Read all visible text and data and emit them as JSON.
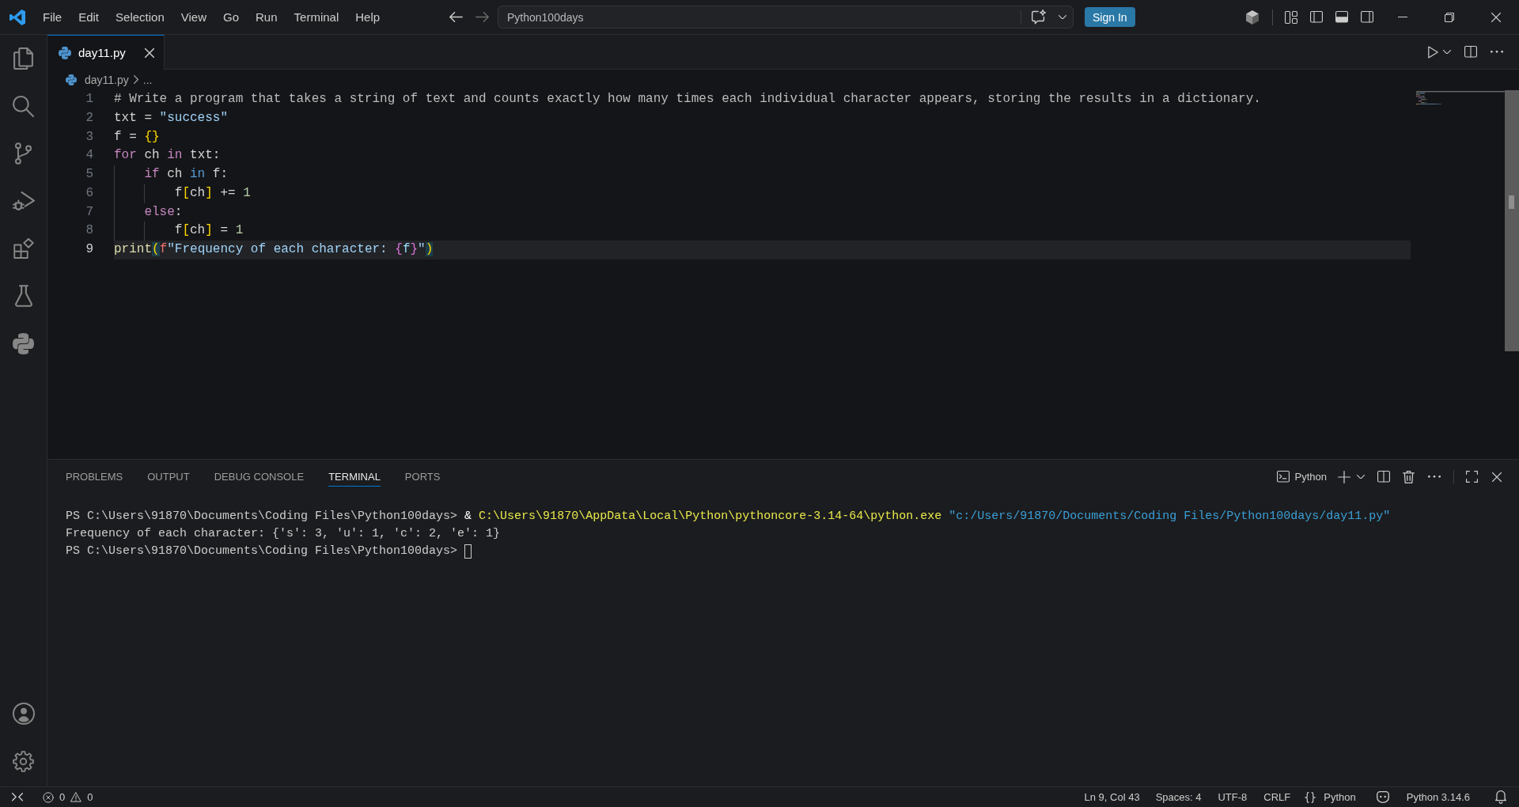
{
  "menu": [
    "File",
    "Edit",
    "Selection",
    "View",
    "Go",
    "Run",
    "Terminal",
    "Help"
  ],
  "nav": [
    {
      "kind": "back",
      "disabled": false
    },
    {
      "kind": "forward",
      "disabled": true
    }
  ],
  "command_center": {
    "label": "Python100days"
  },
  "sign_in": "Sign In",
  "tabs": [
    {
      "label": "day11.py",
      "selected": true
    }
  ],
  "breadcrumb": {
    "file": "day11.py",
    "more": "..."
  },
  "editor": {
    "lines": [
      {
        "number": "1",
        "current": false,
        "tokens": [
          {
            "kind": "comment",
            "text": "# Write a program that takes a string of text and counts exactly how many times each individual character appears, storing the results in a dictionary."
          }
        ]
      },
      {
        "number": "2",
        "current": false,
        "tokens": [
          {
            "kind": "plain",
            "text": "txt = "
          },
          {
            "kind": "string",
            "text": "\"success\""
          }
        ]
      },
      {
        "number": "3",
        "current": false,
        "tokens": [
          {
            "kind": "plain",
            "text": "f = "
          },
          {
            "kind": "bracket",
            "text": "{}"
          }
        ]
      },
      {
        "number": "4",
        "current": false,
        "tokens": [
          {
            "kind": "control",
            "text": "for"
          },
          {
            "kind": "plain",
            "text": " ch "
          },
          {
            "kind": "control",
            "text": "in"
          },
          {
            "kind": "plain",
            "text": " txt:"
          }
        ],
        "children": [
          {
            "number": "5",
            "current": false,
            "tokens": [
              {
                "kind": "control",
                "text": "if"
              },
              {
                "kind": "plain",
                "text": " ch "
              },
              {
                "kind": "keyword",
                "text": "in"
              },
              {
                "kind": "plain",
                "text": " f:"
              }
            ],
            "children": [
              {
                "number": "6",
                "current": false,
                "tokens": [
                  {
                    "kind": "plain",
                    "text": "f"
                  },
                  {
                    "kind": "bracket",
                    "text": "["
                  },
                  {
                    "kind": "plain",
                    "text": "ch"
                  },
                  {
                    "kind": "bracket",
                    "text": "]"
                  },
                  {
                    "kind": "plain",
                    "text": " += "
                  },
                  {
                    "kind": "number",
                    "text": "1"
                  }
                ]
              }
            ]
          },
          {
            "number": "7",
            "current": false,
            "tokens": [
              {
                "kind": "control",
                "text": "else"
              },
              {
                "kind": "plain",
                "text": ":"
              }
            ],
            "children": [
              {
                "number": "8",
                "current": false,
                "tokens": [
                  {
                    "kind": "plain",
                    "text": "f"
                  },
                  {
                    "kind": "bracket",
                    "text": "["
                  },
                  {
                    "kind": "plain",
                    "text": "ch"
                  },
                  {
                    "kind": "bracket",
                    "text": "]"
                  },
                  {
                    "kind": "plain",
                    "text": " = "
                  },
                  {
                    "kind": "number",
                    "text": "1"
                  }
                ]
              }
            ]
          }
        ]
      },
      {
        "number": "9",
        "current": true,
        "tokens": [
          {
            "kind": "function",
            "text": "print"
          },
          {
            "kind": "matched",
            "text": "("
          },
          {
            "kind": "prefix",
            "text": "f"
          },
          {
            "kind": "string",
            "text": "\"Frequency of each character: "
          },
          {
            "kind": "nested",
            "text": "{"
          },
          {
            "kind": "variable",
            "text": "f"
          },
          {
            "kind": "nested",
            "text": "}"
          },
          {
            "kind": "string",
            "text": "\""
          },
          {
            "kind": "matched",
            "text": ")"
          }
        ]
      }
    ]
  },
  "panel": {
    "tabs": [
      {
        "label": "PROBLEMS",
        "selected": false
      },
      {
        "label": "OUTPUT",
        "selected": false
      },
      {
        "label": "DEBUG CONSOLE",
        "selected": false
      },
      {
        "label": "TERMINAL",
        "selected": true
      },
      {
        "label": "PORTS",
        "selected": false
      }
    ],
    "profile": "Python",
    "terminal": {
      "lines": [
        {
          "cursor": false,
          "segments": [
            {
              "kind": "prompt",
              "text": "PS C:\\Users\\91870\\Documents\\Coding Files\\Python100days> "
            },
            {
              "kind": "operator",
              "text": "& "
            },
            {
              "kind": "command",
              "text": "C:\\Users\\91870\\AppData\\Local\\Python\\pythoncore-3.14-64\\python.exe"
            },
            {
              "kind": "argument",
              "text": " \"c:/Users/91870/Documents/Coding Files/Python100days/day11.py\""
            }
          ]
        },
        {
          "cursor": false,
          "segments": [
            {
              "kind": "output",
              "text": "Frequency of each character: {'s': 3, 'u': 1, 'c': 2, 'e': 1}"
            }
          ]
        },
        {
          "cursor": true,
          "segments": [
            {
              "kind": "prompt",
              "text": "PS C:\\Users\\91870\\Documents\\Coding Files\\Python100days> "
            }
          ]
        }
      ]
    }
  },
  "status_bar": {
    "errors": "0",
    "warnings": "0",
    "position": "Ln 9, Col 43",
    "indentation": "Spaces: 4",
    "encoding": "UTF-8",
    "eol": "CRLF",
    "language": "Python",
    "interpreter": "Python 3.14.6"
  }
}
